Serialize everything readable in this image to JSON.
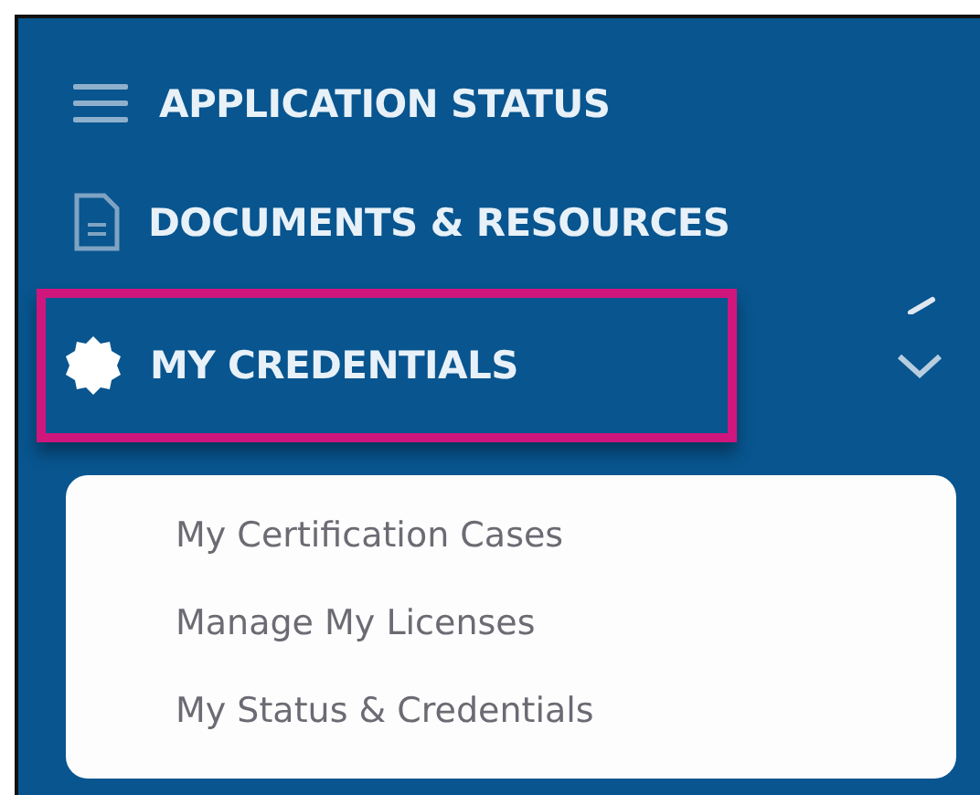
{
  "nav": {
    "items": [
      {
        "kind": "menu",
        "label": "APPLICATION STATUS",
        "selected": false
      },
      {
        "kind": "document",
        "label": "DOCUMENTS & RESOURCES",
        "selected": false
      },
      {
        "kind": "badge",
        "label": "MY CREDENTIALS",
        "selected": true,
        "expanded": true,
        "children": [
          {
            "label": "My Certification Cases"
          },
          {
            "label": "Manage My Licenses"
          },
          {
            "label": "My Status & Credentials"
          }
        ]
      }
    ]
  }
}
